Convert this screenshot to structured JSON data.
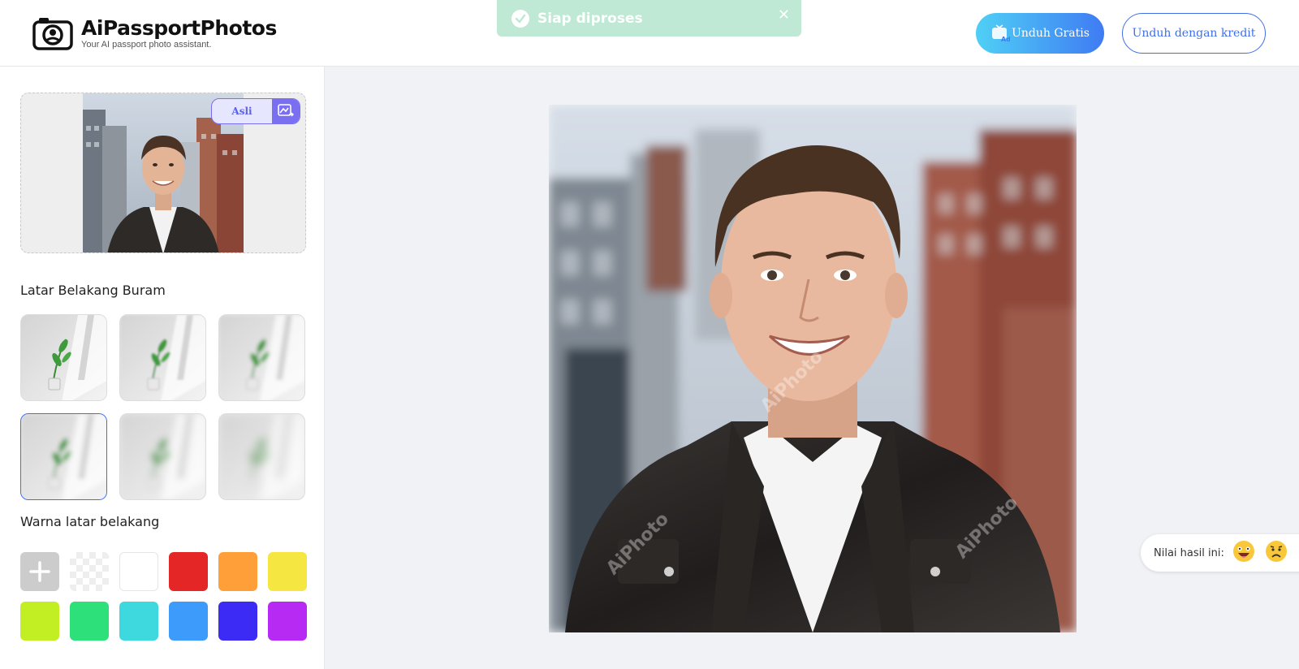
{
  "header": {
    "brand_title": "AiPassportPhotos",
    "brand_subtitle": "Your AI passport photo assistant.",
    "toast_text": "Siap diproses",
    "btn_free_label": "Unduh Gratis",
    "btn_credit_label": "Unduh dengan kredit"
  },
  "sidebar": {
    "toggle_label": "Asli",
    "blur_section_title": "Latar Belakang Buram",
    "color_section_title": "Warna latar belakang",
    "blur_options": [
      {
        "id": "blur-1",
        "selected": false
      },
      {
        "id": "blur-2",
        "selected": false
      },
      {
        "id": "blur-3",
        "selected": false
      },
      {
        "id": "blur-4",
        "selected": true
      },
      {
        "id": "blur-5",
        "selected": false
      },
      {
        "id": "blur-6",
        "selected": false
      }
    ],
    "colors": [
      "custom",
      "transparent",
      "#ffffff",
      "#e52626",
      "#ff9f3a",
      "#f5e641",
      "#c2ef23",
      "#2ee07a",
      "#3dd9df",
      "#3d9cfb",
      "#3c2bf5",
      "#b72af3"
    ]
  },
  "rating": {
    "label": "Nilai hasil ini:"
  },
  "colors": {
    "accent": "#3f6fe8",
    "toast_bg": "#bfe9d4",
    "toggle_accent": "#7a6ff0"
  }
}
